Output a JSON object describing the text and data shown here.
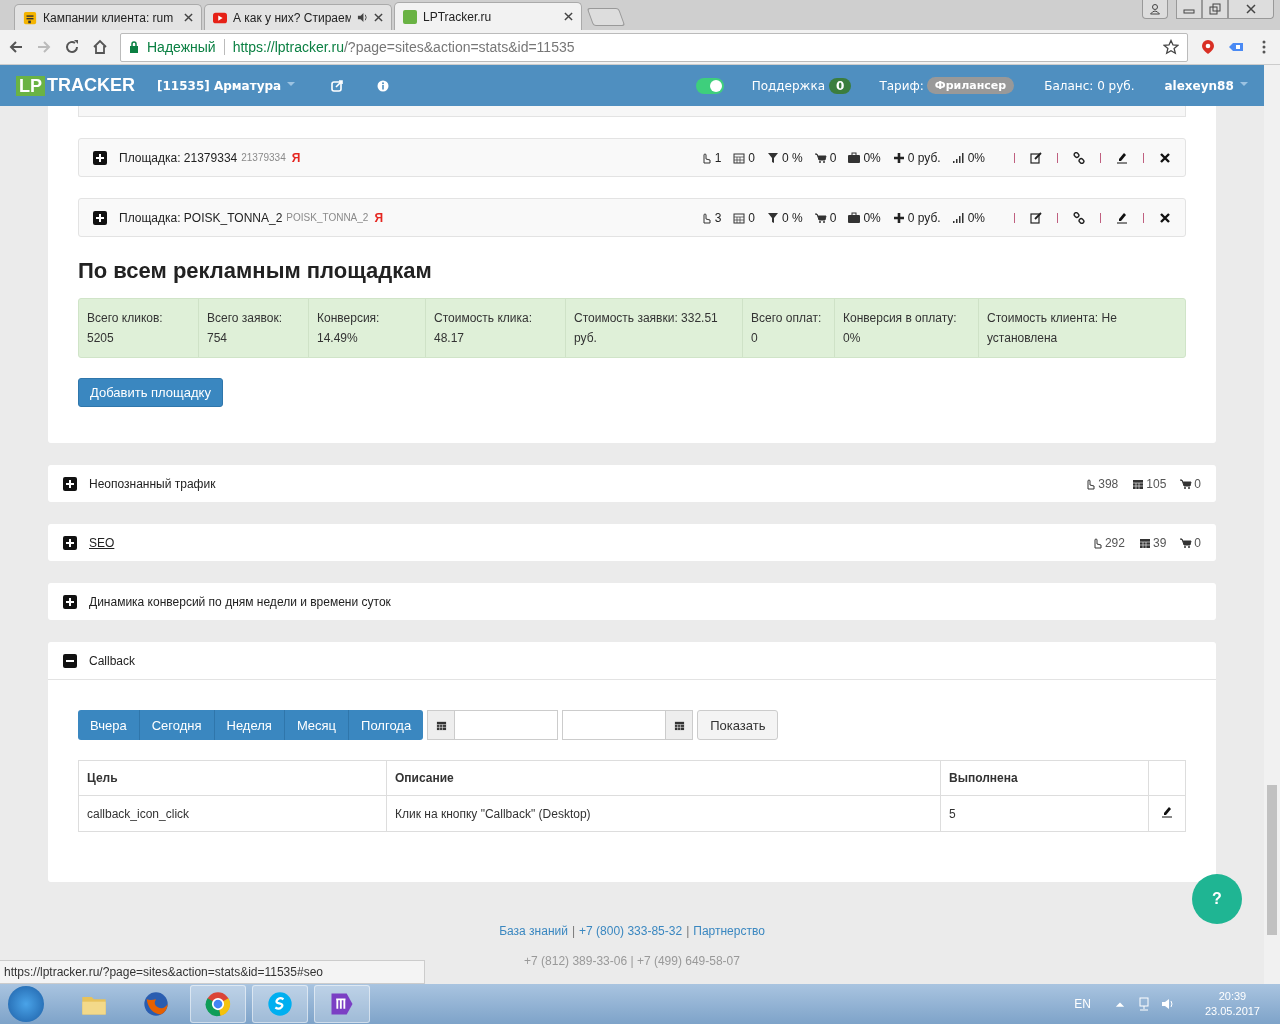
{
  "browser": {
    "tabs": [
      {
        "title": "Кампании клиента: rum",
        "kind": "doc",
        "audio": false,
        "selected": false
      },
      {
        "title": "А как у них? Стираем",
        "kind": "video",
        "audio": true,
        "selected": false
      },
      {
        "title": "LPTracker.ru",
        "kind": "lp",
        "audio": false,
        "selected": true
      }
    ],
    "secure_label": "Надежный",
    "url_host": "https://lptracker.ru",
    "url_path": "/?page=sites&action=stats&id=11535"
  },
  "header": {
    "logo_lp": "LP",
    "logo_tracker": "TRACKER",
    "project": "[11535] Арматура",
    "toggle_on": true,
    "support_label": "Поддержка",
    "support_count": "0",
    "tariff_label": "Тариф:",
    "tariff": "Фрилансер",
    "balance": "Баланс: 0 руб.",
    "user": "alexeyn88"
  },
  "sites": [
    {
      "label": "Площадка: 21379334",
      "sub": "21379334",
      "mark": "Я",
      "stats": [
        {
          "kind": "clicks",
          "value": "1"
        },
        {
          "kind": "leads",
          "value": "0"
        },
        {
          "kind": "funnel",
          "value": "0 %"
        },
        {
          "kind": "cart",
          "value": "0"
        },
        {
          "kind": "case",
          "value": "0%"
        },
        {
          "kind": "plus",
          "value": "0 руб."
        },
        {
          "kind": "signal",
          "value": "0%"
        }
      ]
    },
    {
      "label": "Площадка: POISK_TONNA_2",
      "sub": "POISK_TONNA_2",
      "mark": "Я",
      "stats": [
        {
          "kind": "clicks",
          "value": "3"
        },
        {
          "kind": "leads",
          "value": "0"
        },
        {
          "kind": "funnel",
          "value": "0 %"
        },
        {
          "kind": "cart",
          "value": "0"
        },
        {
          "kind": "case",
          "value": "0%"
        },
        {
          "kind": "plus",
          "value": "0 руб."
        },
        {
          "kind": "signal",
          "value": "0%"
        }
      ]
    }
  ],
  "summary": {
    "title": "По всем рекламным площадкам",
    "cells": [
      {
        "label": "Всего кликов:",
        "value": "5205"
      },
      {
        "label": "Всего заявок:",
        "value": "754"
      },
      {
        "label": "Конверсия:",
        "value": "14.49%"
      },
      {
        "label": "Стоимость клика:",
        "value": "48.17"
      },
      {
        "label": "Стоимость заявки:",
        "value": "332.51 руб."
      },
      {
        "label": "Всего оплат:",
        "value": "0"
      },
      {
        "label": "Конверсия в оплату:",
        "value": "0%"
      },
      {
        "label": "Стоимость клиента:",
        "value": "Не установлена"
      }
    ]
  },
  "add_button": "Добавить площадку",
  "panels": [
    {
      "title": "Неопознанный трафик",
      "link": false,
      "expanded": false,
      "counts": [
        {
          "kind": "clicks",
          "value": "398"
        },
        {
          "kind": "leads",
          "value": "105"
        },
        {
          "kind": "cart",
          "value": "0"
        }
      ]
    },
    {
      "title": "SEO",
      "link": true,
      "expanded": false,
      "counts": [
        {
          "kind": "clicks",
          "value": "292"
        },
        {
          "kind": "leads",
          "value": "39"
        },
        {
          "kind": "cart",
          "value": "0"
        }
      ]
    },
    {
      "title": "Динамика конверсий по дням недели и времени суток",
      "link": false,
      "expanded": false
    },
    {
      "title": "Callback",
      "link": false,
      "expanded": true
    }
  ],
  "callback": {
    "periods": [
      "Вчера",
      "Сегодня",
      "Неделя",
      "Месяц",
      "Полгода"
    ],
    "show_button": "Показать",
    "columns": [
      "Цель",
      "Описание",
      "Выполнена"
    ],
    "rows": [
      {
        "cells": [
          "callback_icon_click",
          "Клик на кнопку \"Callback\" (Desktop)",
          "5"
        ]
      }
    ]
  },
  "footer": {
    "links": [
      "База знаний",
      "+7 (800) 333-85-32",
      "Партнерство"
    ],
    "separator": "|",
    "phones": "+7 (812) 389-33-06 | +7 (499) 649-58-07"
  },
  "help_button": "?",
  "status_url": "https://lptracker.ru/?page=sites&action=stats&id=11535#seo",
  "taskbar": {
    "lang": "EN",
    "time": "20:39",
    "date": "23.05.2017"
  }
}
